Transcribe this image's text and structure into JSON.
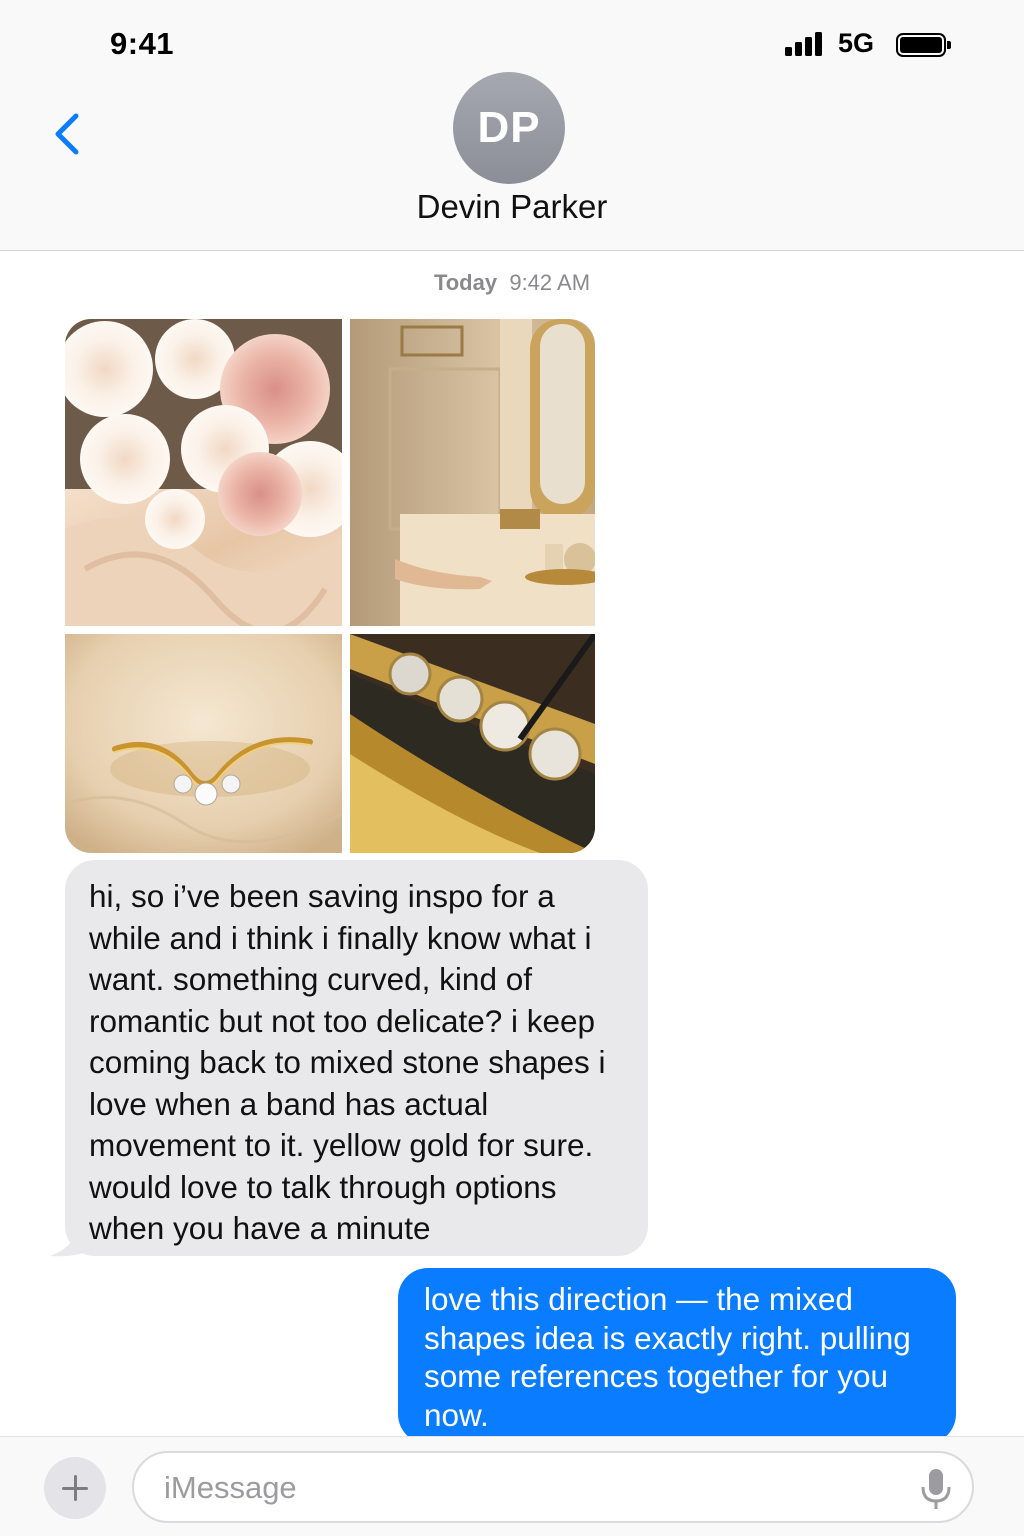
{
  "status_bar": {
    "time": "9:41",
    "network": "5G",
    "signal_bars": 4,
    "battery_level": 1.0
  },
  "header": {
    "avatar_initials": "DP",
    "contact_name": "Devin Parker",
    "back_icon": "chevron-left-icon"
  },
  "conversation": {
    "timestamp_day": "Today",
    "timestamp_time": "9:42 AM",
    "photo_grid": {
      "items": [
        "peony-flowers-silk-photo",
        "vanity-mirror-room-photo",
        "curved-gold-ring-photo",
        "gold-band-diamonds-closeup-photo"
      ]
    },
    "incoming_message": "hi, so i’ve been saving inspo for a while and i think i finally know what i want. something curved, kind of romantic but not too delicate? i keep coming back to mixed stone shapes i love when a band has actual movement to it. yellow gold for sure. would love to talk through options when you have a minute",
    "outgoing_message": "love this direction — the mixed shapes idea is exactly right. pulling some references together for you now."
  },
  "input_bar": {
    "placeholder": "iMessage",
    "value": "",
    "add_icon": "plus-icon",
    "mic_icon": "microphone-icon"
  },
  "colors": {
    "accent_blue": "#0a7cff",
    "incoming_bubble": "#e9e9eb",
    "avatar_gray": "#9a9ca4",
    "timestamp_gray": "#8a8a8e"
  }
}
